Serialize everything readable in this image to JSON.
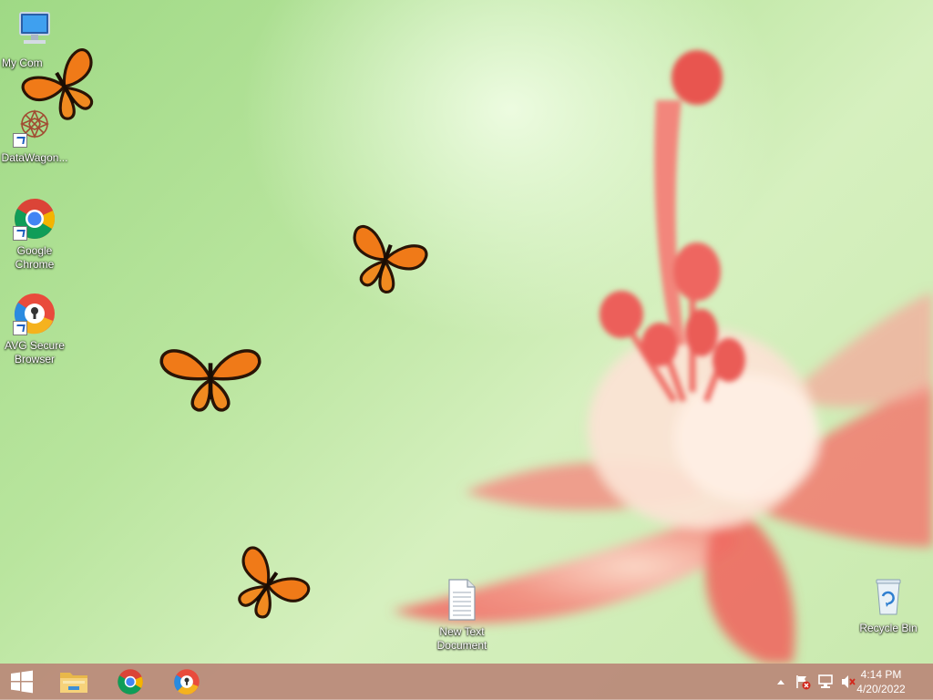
{
  "desktop": {
    "icons": [
      {
        "label": "My Com",
        "icon": "computer-icon"
      },
      {
        "label": "DataWagon...",
        "icon": "datawagon-icon"
      },
      {
        "label": "Google Chrome",
        "icon": "chrome-icon"
      },
      {
        "label": "AVG Secure Browser",
        "icon": "avg-browser-icon"
      },
      {
        "label": "New Text Document",
        "icon": "text-document-icon"
      },
      {
        "label": "Recycle Bin",
        "icon": "recycle-bin-icon"
      }
    ]
  },
  "taskbar": {
    "start": {
      "icon": "windows-start-icon"
    },
    "pinned": [
      {
        "icon": "file-explorer-icon"
      },
      {
        "icon": "chrome-icon"
      },
      {
        "icon": "avg-browser-icon"
      }
    ],
    "tray": {
      "icons": [
        "show-hidden-icons-icon",
        "action-center-flag-icon",
        "network-icon",
        "volume-muted-icon"
      ],
      "time": "4:14 PM",
      "date": "4/20/2022"
    }
  },
  "colors": {
    "taskbar": "#ba8878",
    "wallpaper_green": "#b9e59e",
    "flower_pink": "#f0706a",
    "butterfly_orange": "#f07a18"
  }
}
